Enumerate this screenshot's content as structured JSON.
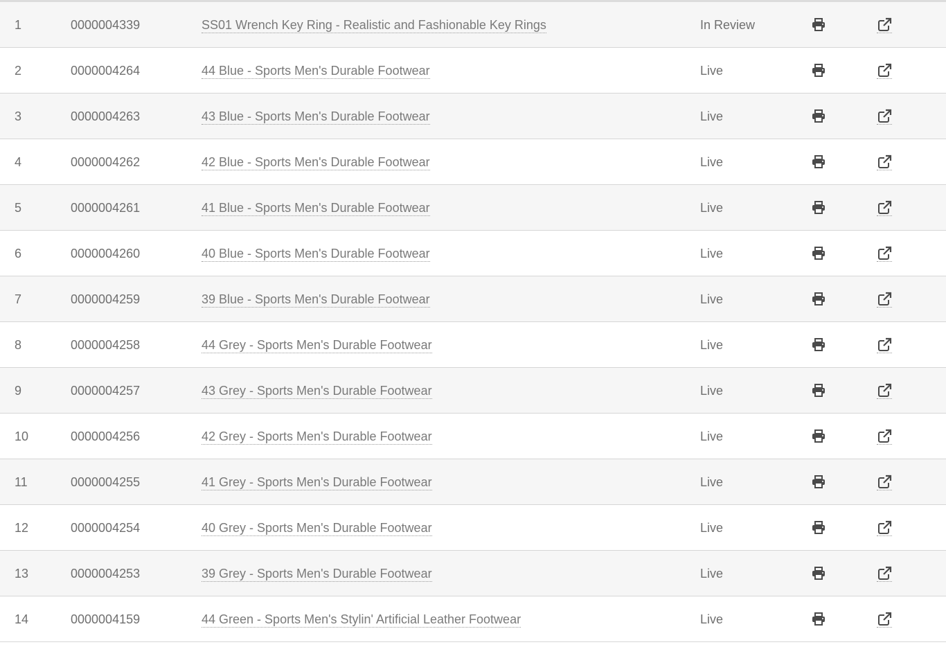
{
  "table": {
    "rows": [
      {
        "index": "1",
        "sku": "0000004339",
        "name": "SS01 Wrench Key Ring - Realistic and Fashionable Key Rings",
        "status": "In Review"
      },
      {
        "index": "2",
        "sku": "0000004264",
        "name": "44 Blue - Sports Men's Durable Footwear",
        "status": "Live"
      },
      {
        "index": "3",
        "sku": "0000004263",
        "name": "43 Blue - Sports Men's Durable Footwear",
        "status": "Live"
      },
      {
        "index": "4",
        "sku": "0000004262",
        "name": "42 Blue - Sports Men's Durable Footwear",
        "status": "Live"
      },
      {
        "index": "5",
        "sku": "0000004261",
        "name": "41 Blue - Sports Men's Durable Footwear",
        "status": "Live"
      },
      {
        "index": "6",
        "sku": "0000004260",
        "name": "40 Blue - Sports Men's Durable Footwear",
        "status": "Live"
      },
      {
        "index": "7",
        "sku": "0000004259",
        "name": "39 Blue - Sports Men's Durable Footwear",
        "status": "Live"
      },
      {
        "index": "8",
        "sku": "0000004258",
        "name": "44 Grey - Sports Men's Durable Footwear",
        "status": "Live"
      },
      {
        "index": "9",
        "sku": "0000004257",
        "name": "43 Grey - Sports Men's Durable Footwear",
        "status": "Live"
      },
      {
        "index": "10",
        "sku": "0000004256",
        "name": "42 Grey - Sports Men's Durable Footwear",
        "status": "Live"
      },
      {
        "index": "11",
        "sku": "0000004255",
        "name": "41 Grey - Sports Men's Durable Footwear",
        "status": "Live"
      },
      {
        "index": "12",
        "sku": "0000004254",
        "name": "40 Grey - Sports Men's Durable Footwear",
        "status": "Live"
      },
      {
        "index": "13",
        "sku": "0000004253",
        "name": "39 Grey - Sports Men's Durable Footwear",
        "status": "Live"
      },
      {
        "index": "14",
        "sku": "0000004159",
        "name": "44 Green - Sports Men's Stylin' Artificial Leather Footwear",
        "status": "Live"
      }
    ],
    "icons": {
      "print": "print-icon",
      "open": "external-link-icon"
    }
  },
  "colors": {
    "text": "#6f6f6f",
    "row_alt": "#f6f6f6",
    "border": "#d6d6d6",
    "icon": "#4a4a4a"
  }
}
